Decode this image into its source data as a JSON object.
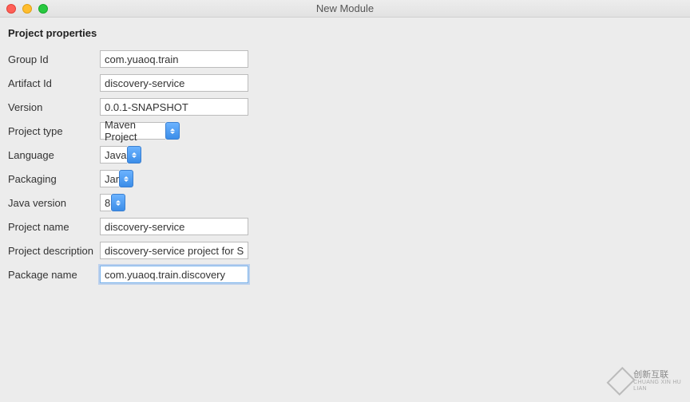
{
  "window": {
    "title": "New Module"
  },
  "section_title": "Project properties",
  "fields": {
    "group_id": {
      "label": "Group Id",
      "value": "com.yuaoq.train"
    },
    "artifact_id": {
      "label": "Artifact Id",
      "value": "discovery-service"
    },
    "version": {
      "label": "Version",
      "value": "0.0.1-SNAPSHOT"
    },
    "project_type": {
      "label": "Project type",
      "value": "Maven Project"
    },
    "language": {
      "label": "Language",
      "value": "Java"
    },
    "packaging": {
      "label": "Packaging",
      "value": "Jar"
    },
    "java_version": {
      "label": "Java version",
      "value": "8"
    },
    "project_name": {
      "label": "Project name",
      "value": "discovery-service"
    },
    "project_description": {
      "label": "Project description",
      "value": "discovery-service project for Spring Boot"
    },
    "package_name": {
      "label": "Package name",
      "value": "com.yuaoq.train.discovery"
    }
  },
  "watermark": {
    "cn": "创新互联",
    "en": "CHUANG XIN HU LIAN"
  }
}
